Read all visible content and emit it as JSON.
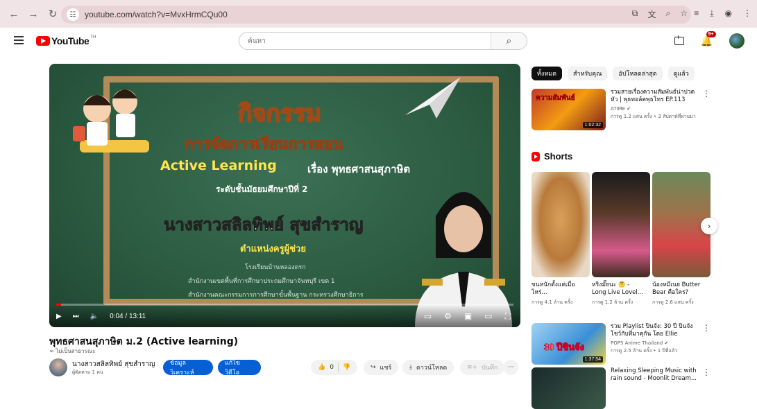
{
  "browser": {
    "url": "youtube.com/watch?v=MvxHrmCQu00"
  },
  "header": {
    "logo_text": "YouTube",
    "logo_sup": "TH",
    "search_placeholder": "ค้นหา",
    "notification_count": "9+"
  },
  "video": {
    "slide_title": "กิจกรรม",
    "slide_line2": "การจัดการเรียนการสอน",
    "slide_line3a": "Active Learning",
    "slide_line3b": "เรื่อง พุทธศาสนสุภาษิต",
    "slide_line4": "ระดับชั้นมัธยมศึกษาปีที่ 2",
    "slide_name": "นางสาวสลิลทิพย์ สุขสำราญ",
    "slide_position": "ตำแหน่งครูผู้ช่วย",
    "slide_school": "โรงเรียนบ้านหลองตรก",
    "slide_office1": "สำนักงานเขตพื้นที่การศึกษาประถมศึกษาจันทบุรี เขต 1",
    "slide_office2": "สำนักงานคณะกรรมการการศึกษาขั้นพื้นฐาน กระทรวงศึกษาธิการ",
    "time": "0:04 / 13:11",
    "progress": 0.005
  },
  "video_info": {
    "title": "พุทธศาสนสุภาษิต ม.2 (Active learning)",
    "visibility": "ไม่เป็นสาธารณะ",
    "channel_name": "นางสาวสลิลทิพย์ สุขสำราญ",
    "subscribers": "ผู้ติดตาม 1 คน",
    "analytics_label": "ข้อมูลวิเคราะห์",
    "edit_label": "แก้ไขวิดีโอ",
    "likes": "0",
    "share_label": "แชร์",
    "download_label": "ดาวน์โหลด",
    "save_label": "บันทึก"
  },
  "chips": [
    "ทั้งหมด",
    "สำหรับคุณ",
    "อัปโหลดล่าสุด",
    "ดูแล้ว"
  ],
  "recommendations": [
    {
      "title": "รวมสายเรื่องความสัมพันธ์น่าปวดหัว | พุธทอล์คพุธโทร EP.113",
      "channel": "ATIME",
      "meta": "การดู 1.2 แสน ครั้ง • 3 สัปดาห์ที่ผ่านมา",
      "duration": "1:02:32",
      "thumb_text": "ความสัมพันธ์"
    },
    {
      "title": "รวม Playlist ปินจัง: 30 ปี ปินจังโชว์กับที่มาคุกัน โดย Ellie",
      "channel": "POPS Anime Thailand",
      "meta": "การดู 2.5 ล้าน ครั้ง • 1 ปีที่แล้ว",
      "duration": "1:37:54",
      "thumb_text": "30 ปีชินจัง"
    },
    {
      "title": "Relaxing Sleeping Music with rain sound - Moonlit Dream...",
      "channel": "",
      "meta": "",
      "duration": "",
      "thumb_text": ""
    }
  ],
  "shorts_label": "Shorts",
  "shorts": [
    {
      "title": "ขนหนักตั้งแต่เมื่อไหร่...",
      "meta": "การดู 4.1 ล้าน ครั้ง"
    },
    {
      "title": "หริงมั๊ยนะ 🤔 - Long Live Lovel...",
      "meta": "การดู 1.2 ล้าน ครั้ง"
    },
    {
      "title": "น้องหมีเนย Butter Bear คือใคร?",
      "meta": "การดู 2.6 แสน ครั้ง"
    }
  ]
}
